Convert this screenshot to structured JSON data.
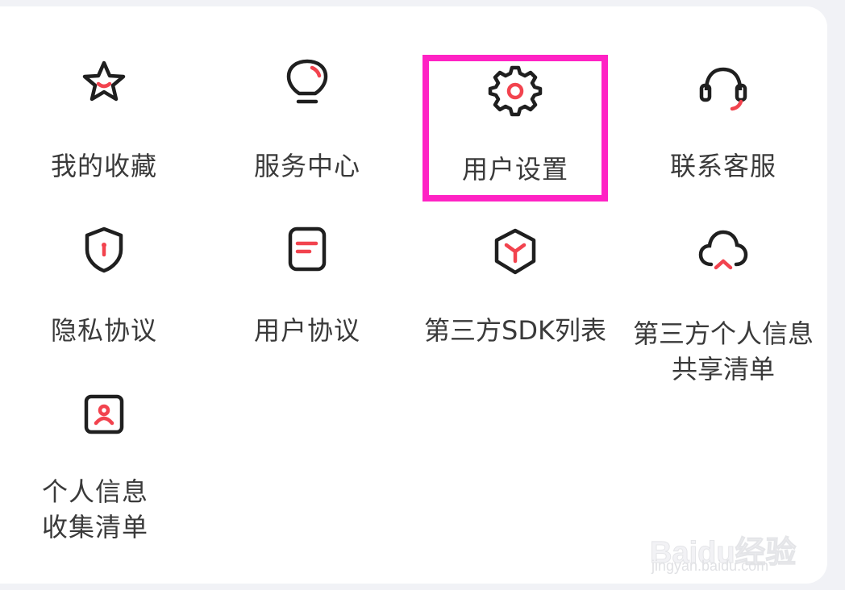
{
  "menu": {
    "items": [
      {
        "id": "favorites",
        "label": "我的收藏",
        "icon": "star-icon"
      },
      {
        "id": "service-center",
        "label": "服务中心",
        "icon": "lightbulb-icon"
      },
      {
        "id": "user-settings",
        "label": "用户设置",
        "icon": "gear-icon",
        "highlighted": true
      },
      {
        "id": "contact-support",
        "label": "联系客服",
        "icon": "headset-icon"
      },
      {
        "id": "privacy-policy",
        "label": "隐私协议",
        "icon": "shield-icon"
      },
      {
        "id": "user-agreement",
        "label": "用户协议",
        "icon": "document-icon"
      },
      {
        "id": "sdk-list",
        "label": "第三方SDK列表",
        "icon": "cube-icon"
      },
      {
        "id": "info-sharing",
        "label_line1": "第三方个人信息",
        "label_line2": "共享清单",
        "icon": "cloud-icon"
      },
      {
        "id": "info-collection",
        "label_line1": "个人信息",
        "label_line2": "收集清单",
        "icon": "profile-card-icon"
      }
    ]
  },
  "colors": {
    "icon_stroke": "#1f1f1f",
    "icon_accent": "#f2434e",
    "highlight": "#ff22c4",
    "label": "#3a3a3a"
  },
  "watermark": {
    "logo": "Baidu经验",
    "url": "jingyan.baidu.com"
  }
}
